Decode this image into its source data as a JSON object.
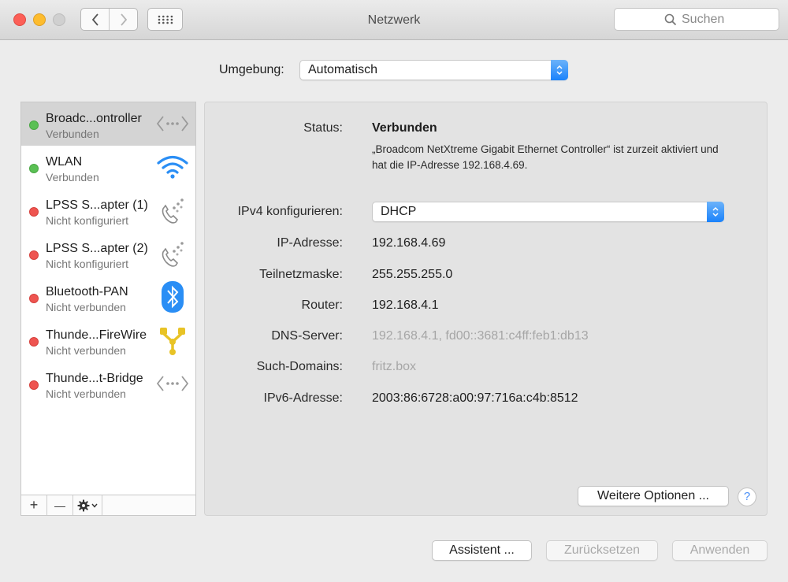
{
  "window": {
    "title": "Netzwerk",
    "search_placeholder": "Suchen"
  },
  "location": {
    "label": "Umgebung:",
    "value": "Automatisch"
  },
  "services": [
    {
      "name": "Broadc...ontroller",
      "status": "Verbunden",
      "state": "green",
      "icon": "ethernet-icon",
      "selected": true
    },
    {
      "name": "WLAN",
      "status": "Verbunden",
      "state": "green",
      "icon": "wifi-icon",
      "selected": false
    },
    {
      "name": "LPSS S...apter (1)",
      "status": "Nicht konfiguriert",
      "state": "red",
      "icon": "phone-icon",
      "selected": false
    },
    {
      "name": "LPSS S...apter (2)",
      "status": "Nicht konfiguriert",
      "state": "red",
      "icon": "phone-icon",
      "selected": false
    },
    {
      "name": "Bluetooth-PAN",
      "status": "Nicht verbunden",
      "state": "red",
      "icon": "bluetooth-icon",
      "selected": false
    },
    {
      "name": "Thunde...FireWire",
      "status": "Nicht verbunden",
      "state": "red",
      "icon": "firewire-icon",
      "selected": false
    },
    {
      "name": "Thunde...t-Bridge",
      "status": "Nicht verbunden",
      "state": "red",
      "icon": "ethernet-icon",
      "selected": false
    }
  ],
  "sidebar_tools": {
    "add": "+",
    "remove": "—"
  },
  "detail": {
    "status_label": "Status:",
    "status_value": "Verbunden",
    "status_description": "„Broadcom NetXtreme Gigabit Ethernet Controller“ ist zurzeit aktiviert und hat die IP-Adresse 192.168.4.69.",
    "ipv4_label": "IPv4 konfigurieren:",
    "ipv4_value": "DHCP",
    "ip_label": "IP-Adresse:",
    "ip_value": "192.168.4.69",
    "subnet_label": "Teilnetzmaske:",
    "subnet_value": "255.255.255.0",
    "router_label": "Router:",
    "router_value": "192.168.4.1",
    "dns_label": "DNS-Server:",
    "dns_value": "192.168.4.1, fd00::3681:c4ff:feb1:db13",
    "domains_label": "Such-Domains:",
    "domains_value": "fritz.box",
    "ipv6_label": "IPv6-Adresse:",
    "ipv6_value": "2003:86:6728:a00:97:716a:c4b:8512",
    "more_options": "Weitere Optionen ...",
    "help": "?"
  },
  "footer": {
    "assistant": "Assistent ...",
    "reset": "Zurücksetzen",
    "apply": "Anwenden"
  },
  "colors": {
    "connected": "#5ac054",
    "disconnected": "#ee5450",
    "accent": "#1a82fb"
  }
}
